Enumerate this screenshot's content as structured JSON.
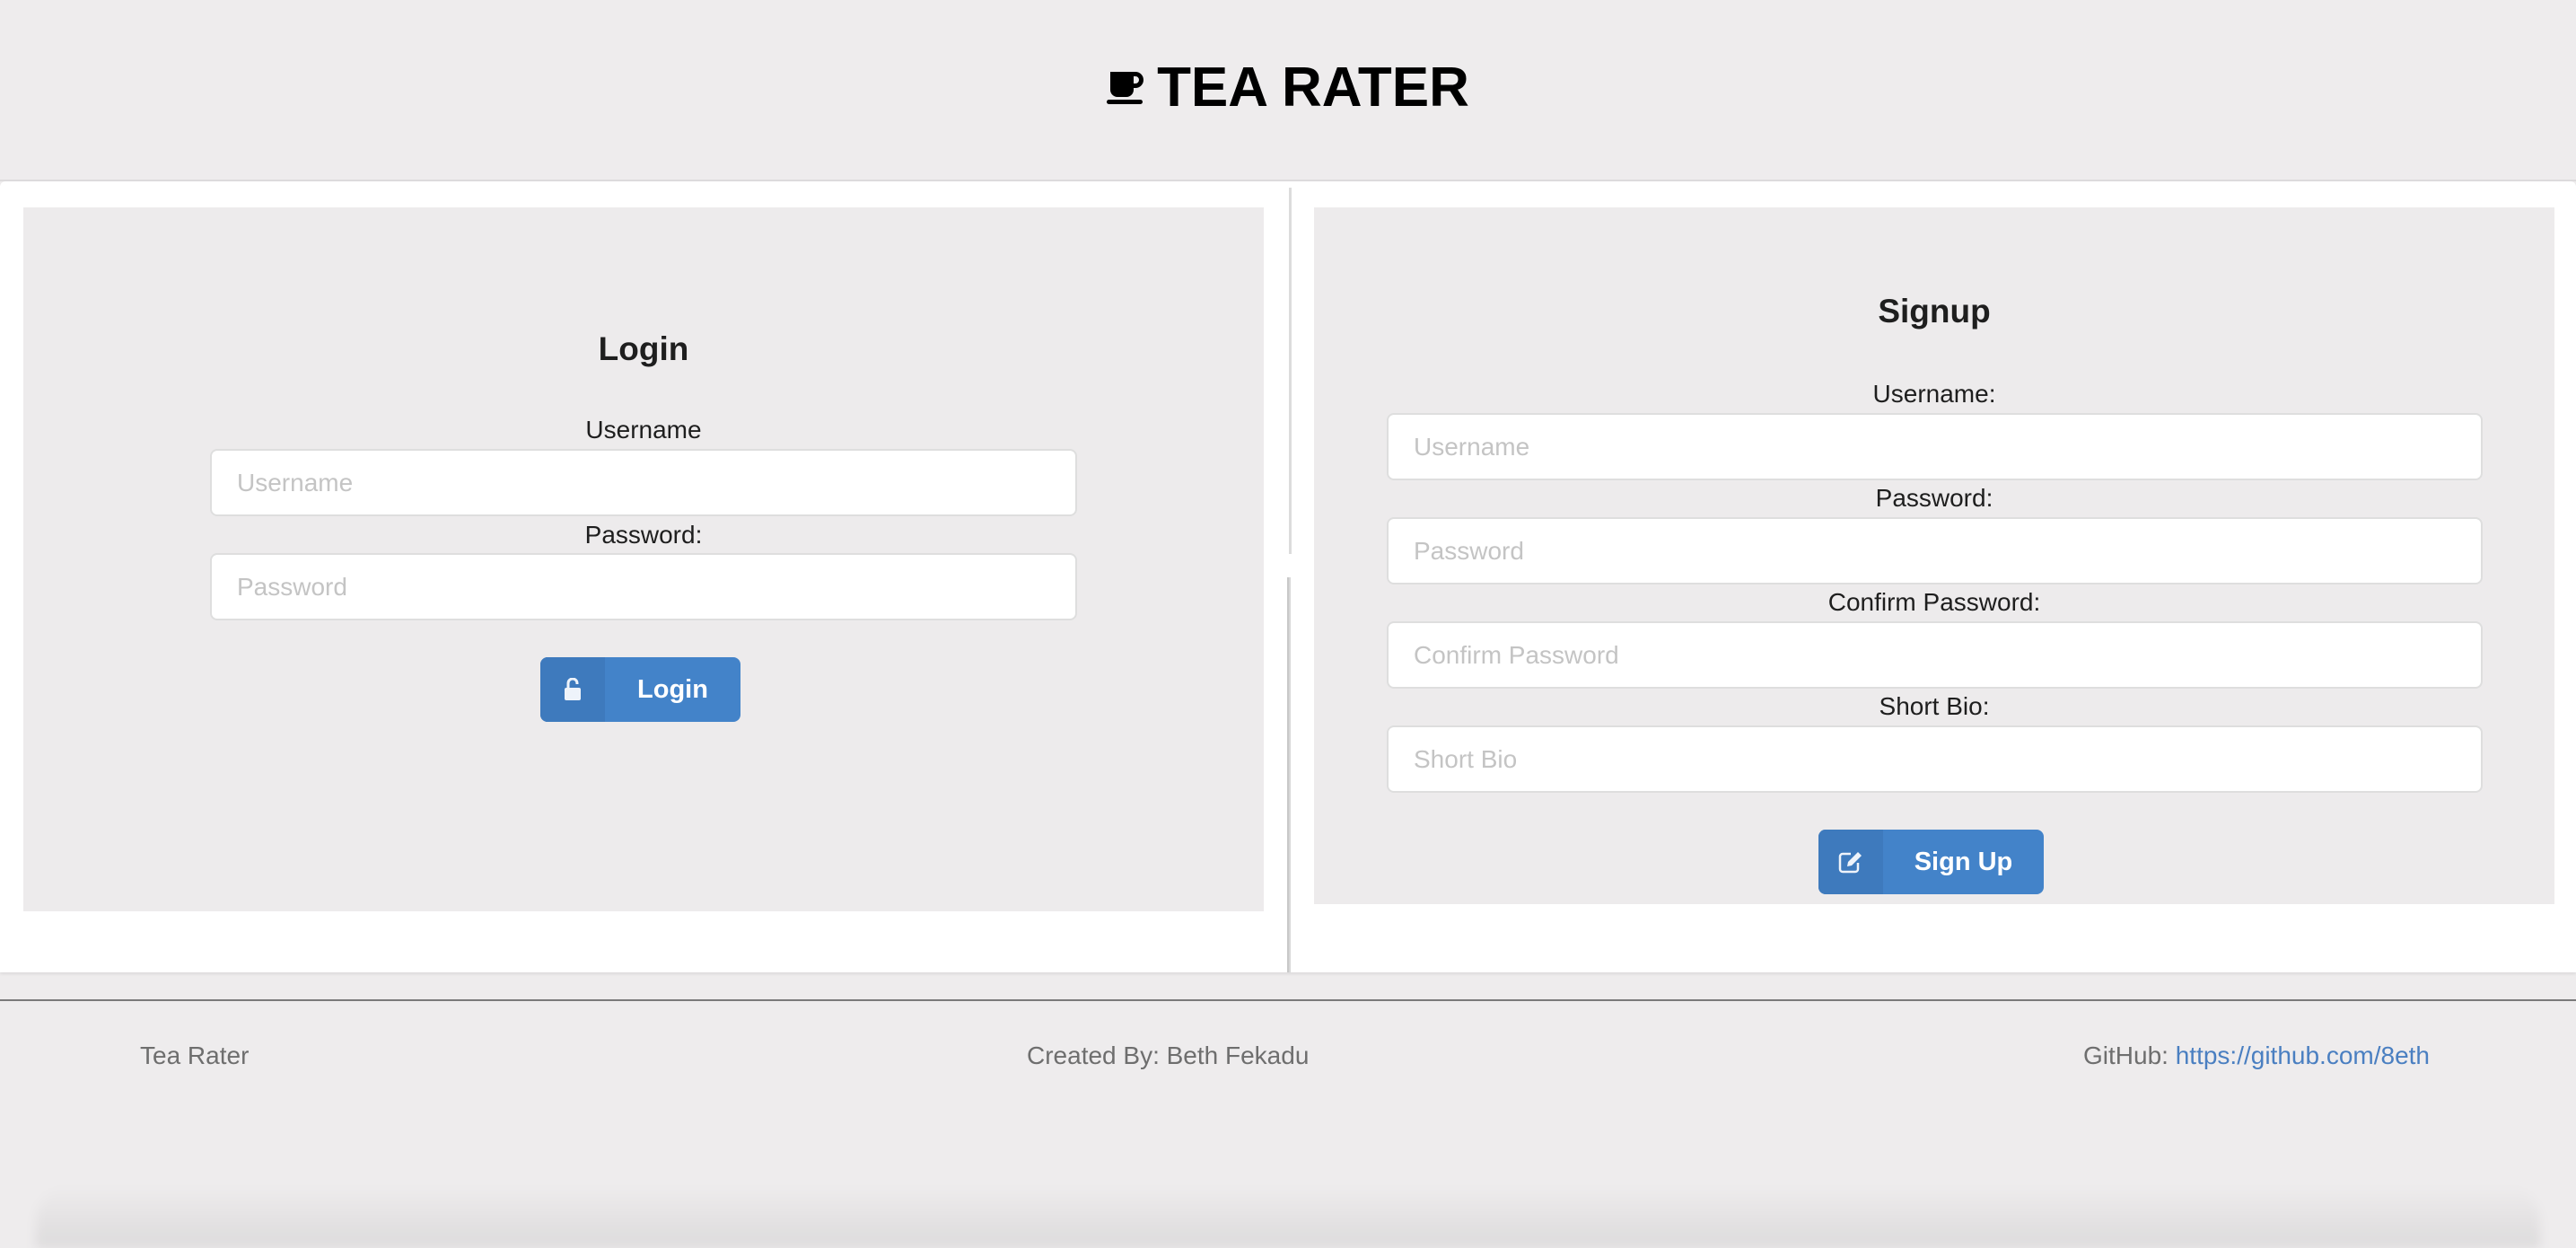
{
  "header": {
    "icon": "coffee-cup-icon",
    "title": "TEA RATER"
  },
  "login": {
    "heading": "Login",
    "username_label": "Username",
    "username_placeholder": "Username",
    "username_value": "",
    "password_label": "Password:",
    "password_placeholder": "Password",
    "password_value": "",
    "button_icon": "unlock-icon",
    "button_label": "Login"
  },
  "signup": {
    "heading": "Signup",
    "username_label": "Username:",
    "username_placeholder": "Username",
    "password_label": "Password:",
    "password_placeholder": "Password",
    "confirm_label": "Confirm Password:",
    "confirm_placeholder": "Confirm Password",
    "bio_label": "Short Bio:",
    "bio_placeholder": "Short Bio",
    "button_icon": "edit-icon",
    "button_label": "Sign Up"
  },
  "footer": {
    "site_name": "Tea Rater",
    "credit": "Created By: Beth Fekadu",
    "github_label": "GitHub:",
    "github_link": "https://github.com/8eth"
  },
  "colors": {
    "button": "#4383c9",
    "button_icon_bg": "#3e7abd",
    "link": "#4a7fc1",
    "background": "#eeeced"
  }
}
